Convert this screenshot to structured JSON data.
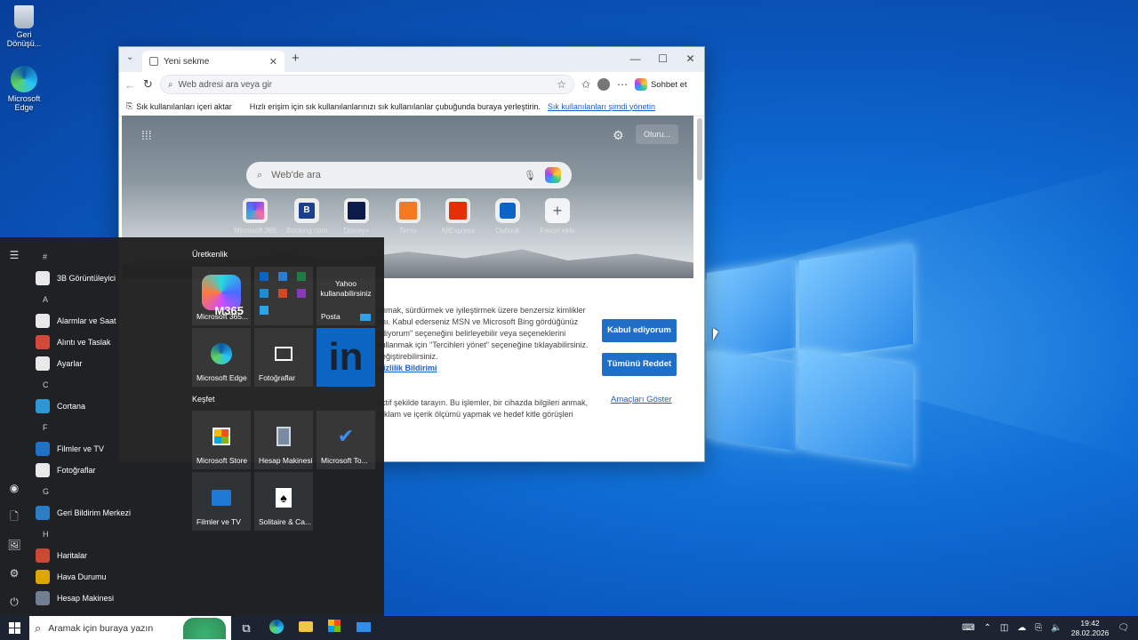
{
  "desktop": {
    "icons": [
      {
        "label": "Geri Dönüşü...",
        "icon": "recycle-bin-icon"
      },
      {
        "label": "Microsoft Edge",
        "icon": "edge-icon"
      }
    ]
  },
  "browser": {
    "tab_title": "Yeni sekme",
    "address_placeholder": "Web adresi ara veya gir",
    "chat_label": "Sohbet et",
    "favbar_import": "Sık kullanılanları içeri aktar",
    "favbar_hint": "Hızlı erişim için sık kullanılanlarınızı sık kullanılanlar çubuğunda buraya yerleştirin.",
    "favbar_link": "Sık kullanılanları şimdi yönetin",
    "ntp_search_placeholder": "Web'de ara",
    "sign_in": "Oturu...",
    "quick_links": [
      "Microsoft 365",
      "Booking.com",
      "Disney+",
      "Temu",
      "AliExpress",
      "Outlook",
      "Favori ekle"
    ],
    "quick_links_letters": [
      "B",
      "+"
    ],
    "consent": {
      "para1": "anmak, sürdürmek ve iyileştirmek üzere benzersiz kimlikler anı. Kabul ederseniz MSN ve Microsoft Bing gördüğünüz ediyorum\" seçeneğini belirleyebilir veya seçeneklerini kullanmak için \"Tercihleri yönet\" seçeneğine tıklayabilirsiniz. değiştirebilirsiniz.",
      "privacy_link": "Gizlilik Bildirimi",
      "para2": "aktif şekilde tarayın. Bu işlemler, bir cihazda bilgileri anmak, reklam ve içerik ölçümü yapmak ve hedef kitle görüşleri",
      "accept": "Kabul ediyorum",
      "reject": "Tümünü Reddet",
      "purposes": "Amaçları Göster"
    }
  },
  "start_menu": {
    "app_list": [
      {
        "type": "header",
        "label": "#"
      },
      {
        "type": "app",
        "label": "3B Görüntüleyici",
        "icon": "cube-icon",
        "color": "#ffffff"
      },
      {
        "type": "header",
        "label": "A"
      },
      {
        "type": "app",
        "label": "Alarmlar ve Saat",
        "icon": "clock-icon",
        "color": "#ffffff"
      },
      {
        "type": "app",
        "label": "Alıntı ve Taslak",
        "icon": "snip-icon",
        "color": "#e74c3c"
      },
      {
        "type": "app",
        "label": "Ayarlar",
        "icon": "gear-icon",
        "color": "#ffffff"
      },
      {
        "type": "header",
        "label": "C"
      },
      {
        "type": "app",
        "label": "Cortana",
        "icon": "cortana-icon",
        "color": "#2fa3e8"
      },
      {
        "type": "header",
        "label": "F"
      },
      {
        "type": "app",
        "label": "Filmler ve TV",
        "icon": "film-icon",
        "color": "#1f7ad6"
      },
      {
        "type": "app",
        "label": "Fotoğraflar",
        "icon": "photos-icon",
        "color": "#ffffff"
      },
      {
        "type": "header",
        "label": "G"
      },
      {
        "type": "app",
        "label": "Geri Bildirim Merkezi",
        "icon": "feedback-icon",
        "color": "#2b88d8"
      },
      {
        "type": "header",
        "label": "H"
      },
      {
        "type": "app",
        "label": "Haritalar",
        "icon": "maps-icon",
        "color": "#e04d35"
      },
      {
        "type": "app",
        "label": "Hava Durumu",
        "icon": "weather-icon",
        "color": "#f4b400"
      },
      {
        "type": "app",
        "label": "Hesap Makinesi",
        "icon": "calculator-icon",
        "color": "#7a8aa0"
      }
    ],
    "groups": {
      "productivity": "Üretkenlik",
      "explore": "Keşfet"
    },
    "tiles": [
      {
        "label": "Microsoft 365...",
        "badge": "M365",
        "icon": "m365-icon"
      },
      {
        "label": "",
        "icon": "office-apps-icon"
      },
      {
        "label": "Posta",
        "text": "Yahoo kullanabilirsiniz",
        "icon": "mail-icon"
      },
      {
        "label": "Microsoft Edge",
        "icon": "edge-icon"
      },
      {
        "label": "Fotoğraflar",
        "icon": "photos-icon"
      },
      {
        "label": "",
        "text": "in",
        "icon": "linkedin-icon"
      },
      {
        "label": "Microsoft Store",
        "icon": "store-icon"
      },
      {
        "label": "Hesap Makinesi",
        "icon": "calculator-icon"
      },
      {
        "label": "Microsoft To...",
        "icon": "todo-icon"
      },
      {
        "label": "Filmler ve TV",
        "icon": "film-icon"
      },
      {
        "label": "Solitaire & Ca...",
        "icon": "solitaire-icon"
      }
    ]
  },
  "taskbar": {
    "search_placeholder": "Aramak için buraya yazın",
    "time": "19:42",
    "date": "28.02.2026"
  }
}
